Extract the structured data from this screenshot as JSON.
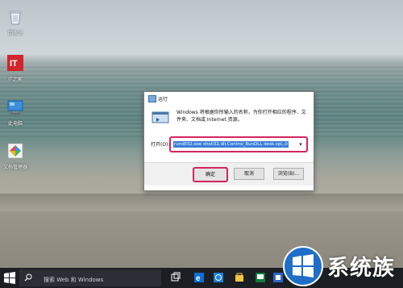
{
  "desktop": {
    "icons": [
      {
        "label": "回收站",
        "icon": "recycle-bin-icon"
      },
      {
        "label": "IT之家",
        "icon": "it-app-icon"
      },
      {
        "label": "此电脑",
        "icon": "this-pc-icon"
      },
      {
        "label": "文档管理器",
        "icon": "photo-app-icon"
      }
    ]
  },
  "run_dialog": {
    "title": "运行",
    "description": "Windows 将根据你所输入的名称，为你打开相应的程序、文件夹、文档或 Internet 资源。",
    "open_label": "打开(O):",
    "command_value": "rundll32.exe shell32.dll,Control_RunDLL desk.cpl,,0",
    "ok_label": "确定",
    "cancel_label": "取消",
    "browse_label": "浏览(B)...",
    "highlight_color": "#d3245e"
  },
  "taskbar": {
    "search_placeholder": "搜索 Web 和 Windows",
    "icons": [
      "task-view-icon",
      "edge-browser-icon",
      "file-explorer-icon",
      "store-icon",
      "run-app-icon",
      "app-icon"
    ]
  },
  "watermark": {
    "text": "系统族"
  }
}
